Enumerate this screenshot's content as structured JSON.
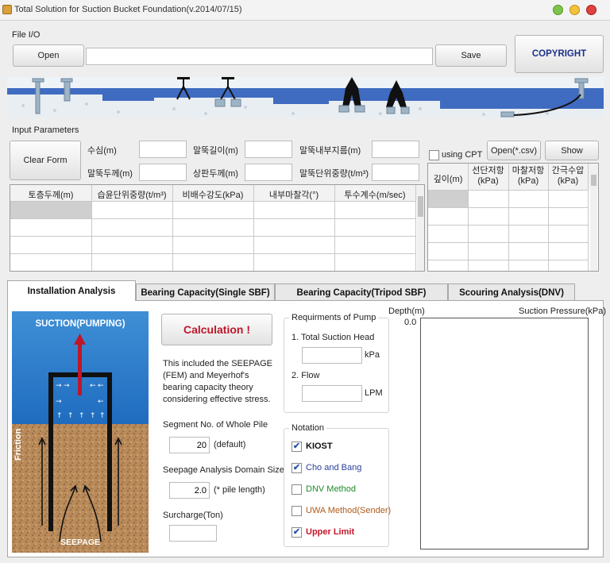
{
  "window": {
    "title": "Total Solution for Suction Bucket Foundation(v.2014/07/15)"
  },
  "file_io": {
    "label": "File I/O",
    "open": "Open",
    "path_value": "",
    "save": "Save",
    "copyright": "COPYRIGHT"
  },
  "input": {
    "label": "Input Parameters",
    "clear": "Clear Form",
    "fields": [
      {
        "label": "수심(m)",
        "value": ""
      },
      {
        "label": "말뚝길이(m)",
        "value": ""
      },
      {
        "label": "말뚝내부지름(m)",
        "value": ""
      },
      {
        "label": "말뚝두께(m)",
        "value": ""
      },
      {
        "label": "상판두께(m)",
        "value": ""
      },
      {
        "label": "말뚝단위중량(t/m³)",
        "value": ""
      }
    ],
    "using_cpt": "using CPT",
    "open_csv": "Open(*.csv)",
    "show": "Show",
    "soil_headers": [
      "토층두께(m)",
      "습윤단위중량(t/m³)",
      "비배수강도(kPa)",
      "내부마찰각(°)",
      "투수계수(m/sec)"
    ],
    "cpt_headers": [
      "깊이(m)",
      "선단저항\n(kPa)",
      "마찰저항\n(kPa)",
      "간극수압\n(kPa)"
    ]
  },
  "tabs": [
    {
      "label": "Installation Analysis"
    },
    {
      "label": "Bearing Capacity(Single SBF)"
    },
    {
      "label": "Bearing Capacity(Tripod SBF)"
    },
    {
      "label": "Scouring Analysis(DNV)"
    }
  ],
  "analysis": {
    "diagram_title": "SUCTION(PUMPING)",
    "friction": "Friction",
    "seepage": "SEEPAGE",
    "calc": "Calculation !",
    "description": "This included the SEEPAGE (FEM) and Meyerhof's bearing capacity theory considering effective stress.",
    "segment_label": "Segment No. of Whole Pile",
    "segment_value": "20",
    "segment_hint": "(default)",
    "seepage_label": "Seepage Analysis Domain Size",
    "seepage_value": "2.0",
    "seepage_hint": "(* pile length)",
    "surcharge_label": "Surcharge(Ton)",
    "surcharge_value": ""
  },
  "pump": {
    "title": "Requirments of Pump",
    "head_label": "1. Total Suction Head",
    "head_value": "",
    "head_unit": "kPa",
    "flow_label": "2. Flow",
    "flow_value": "",
    "flow_unit": "LPM"
  },
  "notation": {
    "title": "Notation",
    "items": [
      {
        "label": "KIOST",
        "checked": true,
        "color": "#111111",
        "bold": true
      },
      {
        "label": "Cho and Bang",
        "checked": true,
        "color": "#2a3f9c",
        "bold": false
      },
      {
        "label": "DNV Method",
        "checked": false,
        "color": "#1f8a2a",
        "bold": false
      },
      {
        "label": "UWA Method(Sender)",
        "checked": false,
        "color": "#b05a1a",
        "bold": false
      },
      {
        "label": "Upper Limit",
        "checked": true,
        "color": "#c0162a",
        "bold": true
      }
    ]
  },
  "plot": {
    "depth_label": "Depth(m)",
    "pressure_label": "Suction Pressure(kPa)",
    "origin": "0.0"
  }
}
